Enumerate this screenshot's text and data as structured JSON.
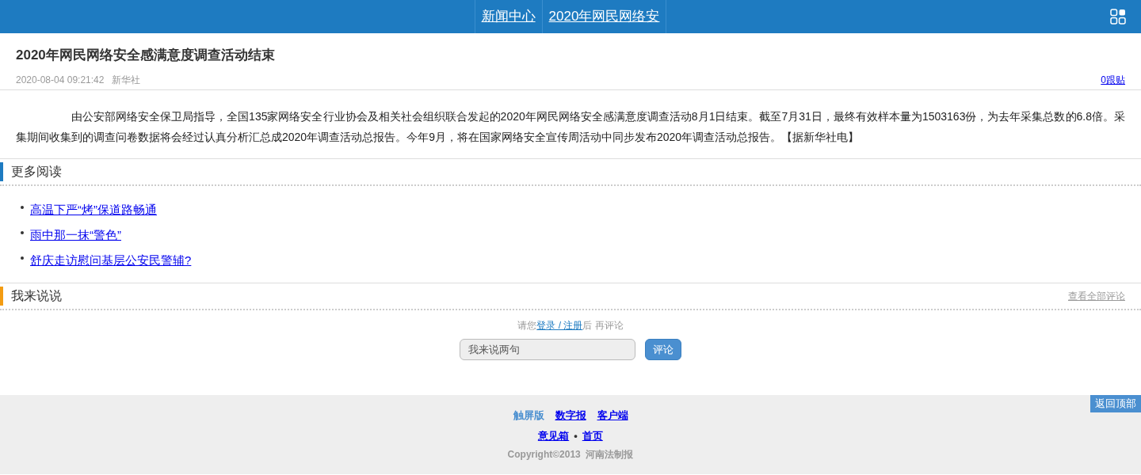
{
  "header": {
    "nav": [
      {
        "label": "新闻中心"
      },
      {
        "label": "2020年网民网络安"
      }
    ]
  },
  "article": {
    "title": "2020年网民网络安全感满意度调查活动结束",
    "date": "2020-08-04 09:21:42",
    "source": "新华社",
    "replies": "0跟贴",
    "body": "由公安部网络安全保卫局指导，全国135家网络安全行业协会及相关社会组织联合发起的2020年网民网络安全感满意度调查活动8月1日结束。截至7月31日，最终有效样本量为1503163份，为去年采集总数的6.8倍。采集期间收集到的调查问卷数据将会经过认真分析汇总成2020年调查活动总报告。今年9月，将在国家网络安全宣传周活动中同步发布2020年调查活动总报告。【据新华社电】"
  },
  "more_reading": {
    "title": "更多阅读",
    "color": "#1e7bc1",
    "links": [
      "高温下严“烤”保道路畅通",
      "雨中那一抹“警色”",
      "舒庆走访慰问基层公安民警辅?"
    ]
  },
  "comments": {
    "title": "我来说说",
    "color": "#f39c12",
    "view_all": "查看全部评论",
    "prompt_before": "请您",
    "login_link": "登录 / 注册",
    "prompt_after": "后 再评论",
    "input": {
      "placeholder": "我来说两句"
    },
    "submit": "评论"
  },
  "back_to_top": "返回顶部",
  "footer": {
    "links": [
      {
        "label": "触屏版",
        "selected": true
      },
      {
        "label": "数字报",
        "selected": false
      },
      {
        "label": "客户端",
        "selected": false
      }
    ],
    "links2": [
      "意见箱",
      "首页"
    ],
    "separator": "•",
    "copyright": "Copyright©2013  河南法制报"
  }
}
